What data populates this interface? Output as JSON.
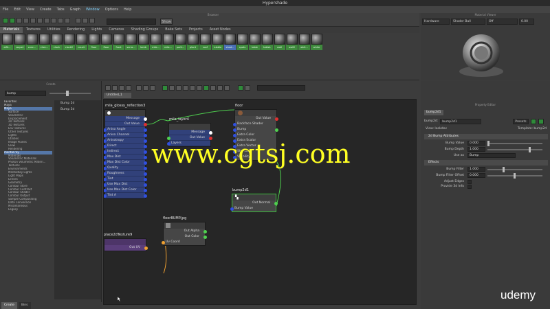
{
  "window": {
    "title": "Hypershade"
  },
  "menu": [
    "File",
    "Edit",
    "View",
    "Create",
    "Tabs",
    "Graph",
    "Window",
    "Options",
    "Help"
  ],
  "menu_active": "Window",
  "browser": {
    "title": "Browser",
    "show_label": "Show",
    "tabs": [
      "Materials",
      "Textures",
      "Utilities",
      "Rendering",
      "Lights",
      "Cameras",
      "Shading Groups",
      "Bake Sets",
      "Projects",
      "Asset Nodes"
    ],
    "active_tab": "Materials",
    "swatches": [
      "aiSt...",
      "carpet",
      "conc...",
      "chec...",
      "clock",
      "clock2",
      "couch",
      "floor",
      "floor",
      "frost",
      "serro...",
      "lamb",
      "mila...",
      "mila...",
      "parti...",
      "plant",
      "roof",
      "rubble",
      "shad...",
      "spots",
      "table",
      "tableL",
      "wall",
      "wall2",
      "whit...",
      "white"
    ],
    "selected_swatch": "shad..."
  },
  "material_viewer": {
    "title": "Material Viewer",
    "renderer": "Hardware",
    "geometry": "Shader Ball",
    "extra": "Off",
    "exposure": "0.00"
  },
  "create": {
    "title": "Create",
    "search": "bump",
    "tree": [
      {
        "label": "Favorites",
        "level": "cat"
      },
      {
        "label": "Maya",
        "level": "cat"
      },
      {
        "label": "Maya",
        "level": "sel"
      },
      {
        "label": "Surface",
        "level": "sub"
      },
      {
        "label": "Volumetric",
        "level": "sub"
      },
      {
        "label": "Displacement",
        "level": "sub"
      },
      {
        "label": "2D Textures",
        "level": "sub"
      },
      {
        "label": "3D Textures",
        "level": "sub"
      },
      {
        "label": "Env Textures",
        "level": "sub"
      },
      {
        "label": "Other Textures",
        "level": "sub"
      },
      {
        "label": "Lights",
        "level": "sub"
      },
      {
        "label": "Utilities",
        "level": "sub"
      },
      {
        "label": "Image Planes",
        "level": "sub"
      },
      {
        "label": "Glow",
        "level": "sub"
      },
      {
        "label": "Rendering",
        "level": "sub"
      },
      {
        "label": "mental ray",
        "level": "sel"
      },
      {
        "label": "Materials",
        "level": "sub"
      },
      {
        "label": "Volumetric Materials",
        "level": "sub"
      },
      {
        "label": "Photon Volumetric Materi...",
        "level": "sub"
      },
      {
        "label": "Textures",
        "level": "sub"
      },
      {
        "label": "Environments",
        "level": "sub"
      },
      {
        "label": "MentalRay Lights",
        "level": "sub"
      },
      {
        "label": "Light Maps",
        "level": "sub"
      },
      {
        "label": "Lenses",
        "level": "sub"
      },
      {
        "label": "Geometry",
        "level": "sub"
      },
      {
        "label": "Contour Store",
        "level": "sub"
      },
      {
        "label": "Contour Contrast",
        "level": "sub"
      },
      {
        "label": "Contour Shader",
        "level": "sub"
      },
      {
        "label": "Contour Output",
        "level": "sub"
      },
      {
        "label": "Sample Compositing",
        "level": "sub"
      },
      {
        "label": "Data Conversion",
        "level": "sub"
      },
      {
        "label": "Miscellaneous",
        "level": "sub"
      },
      {
        "label": "Legacy",
        "level": "sub"
      }
    ],
    "results": [
      "Bump 2d",
      "Bump 3d"
    ],
    "bottom_tabs": [
      "Create",
      "Bins"
    ]
  },
  "node_editor": {
    "tab": "Untitled_1",
    "nodes": {
      "glossy": {
        "title": "mila_glossy_reflection3",
        "rows": [
          "Message",
          "Out Value",
          "Aniso Angle",
          "Aniso Channel",
          "Anisotropy",
          "Direct",
          "Indirect",
          "Max Dist",
          "Max Dist Color",
          "Quality",
          "Roughness",
          "Tint",
          "Use Max Dist",
          "Use Max Dist Color",
          "Tint A"
        ]
      },
      "layer": {
        "title": "mila_layer4",
        "rows": [
          "Message",
          "Out Value",
          "Layers"
        ]
      },
      "floor": {
        "title": "floor",
        "rows": [
          "Out Value",
          "Backface Shader",
          "Bump",
          "Extra Color",
          "Extra Scalar",
          "Extra Vector",
          "Shadow",
          "Visibility"
        ]
      },
      "bump": {
        "title": "bump2d1",
        "rows": [
          "Out Normal",
          "Bump Value"
        ]
      },
      "file": {
        "title": "floorBUMP.jpg",
        "rows": [
          "Out Alpha",
          "Out Color",
          "Uv Coord"
        ]
      },
      "place": {
        "title": "place2dTexture9",
        "rows": [
          "Out UV"
        ]
      }
    }
  },
  "attribute_editor": {
    "title": "Property Editor",
    "tab": "bump2d1",
    "node_type_label": "bump2d:",
    "node_name": "bump2d1",
    "presets": "Presets",
    "view_label": "View:",
    "view_value": "lookdev",
    "template_label": "Template:",
    "template_value": "bump2d",
    "sections": {
      "attrs": "2d Bump Attributes",
      "effects": "Effects"
    },
    "rows": {
      "bump_value": {
        "label": "Bump Value",
        "value": "0.000"
      },
      "bump_depth": {
        "label": "Bump Depth",
        "value": "1.000"
      },
      "use_as": {
        "label": "Use as",
        "value": "Bump"
      },
      "bump_filter": {
        "label": "Bump Filter",
        "value": "1.000"
      },
      "bump_filter_offset": {
        "label": "Bump Filter Offset",
        "value": "0.000"
      },
      "adjust_edges": {
        "label": "Adjust Edges"
      },
      "provide_3d": {
        "label": "Provide 3d Info"
      }
    }
  },
  "overlays": {
    "watermark": "www.cgtsj.com",
    "brand": "udemy"
  },
  "colors": {
    "swatch_label": "#3f8a3d",
    "blue_node": "#31417a",
    "connection_green": "#4fd14f",
    "connection_orange": "#f0a030",
    "watermark": "#ffff22"
  }
}
